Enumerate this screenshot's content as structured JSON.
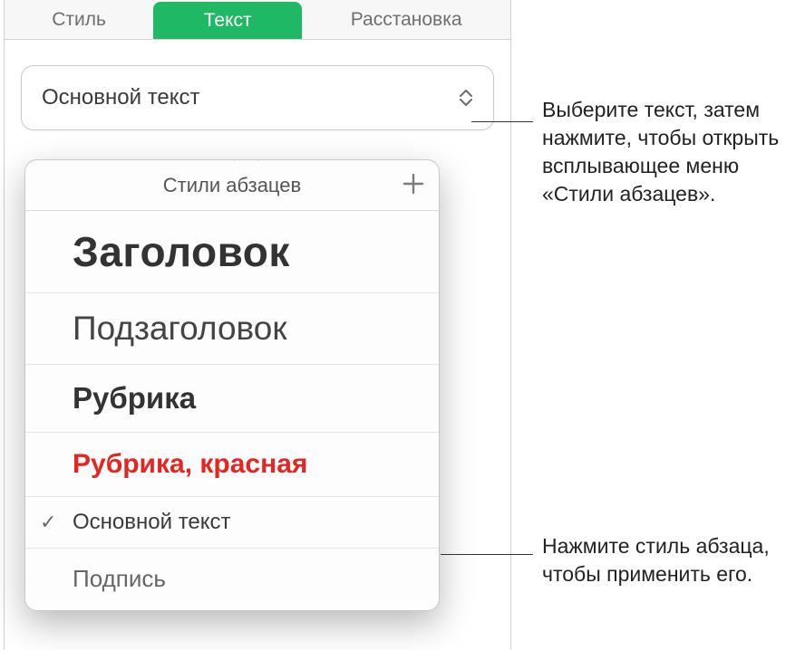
{
  "tabs": {
    "style": "Стиль",
    "text": "Текст",
    "arrange": "Расстановка"
  },
  "style_field": {
    "current": "Основной текст"
  },
  "popup": {
    "title": "Стили абзацев",
    "items": {
      "title": "Заголовок",
      "subtitle": "Подзаголовок",
      "heading": "Рубрика",
      "heading_red": "Рубрика, красная",
      "body": "Основной текст",
      "caption": "Подпись"
    }
  },
  "callouts": {
    "top": "Выберите текст, затем нажмите, чтобы открыть всплывающее меню «Стили абзацев».",
    "bottom": "Нажмите стиль абзаца, чтобы применить его."
  }
}
